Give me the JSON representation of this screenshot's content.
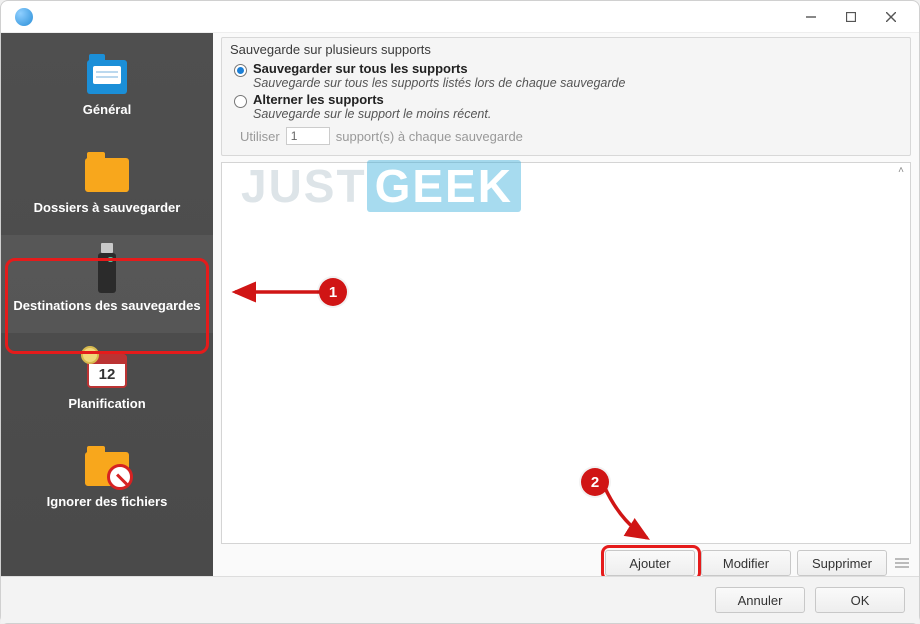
{
  "titlebar": {
    "app_name": ""
  },
  "sidebar": {
    "items": [
      {
        "label": "Général",
        "icon": "settings-folder-icon"
      },
      {
        "label": "Dossiers à sauvegarder",
        "icon": "folder-icon"
      },
      {
        "label": "Destinations des sauvegardes",
        "icon": "usb-icon"
      },
      {
        "label": "Planification",
        "icon": "calendar-icon",
        "calendar_day": "12"
      },
      {
        "label": "Ignorer des fichiers",
        "icon": "folder-blocked-icon"
      }
    ],
    "active_index": 2
  },
  "group": {
    "title": "Sauvegarde sur plusieurs supports",
    "option_all": {
      "label": "Sauvegarder sur tous les supports",
      "desc": "Sauvegarde sur tous les supports listés lors de chaque sauvegarde"
    },
    "option_alt": {
      "label": "Alterner les supports",
      "desc": "Sauvegarde sur le support le moins récent."
    },
    "stepper_prefix": "Utiliser",
    "stepper_value": "1",
    "stepper_suffix": "support(s) à chaque sauvegarde"
  },
  "list_buttons": {
    "add": "Ajouter",
    "edit": "Modifier",
    "delete": "Supprimer"
  },
  "footer": {
    "cancel": "Annuler",
    "ok": "OK"
  },
  "annotations": {
    "badge1": "1",
    "badge2": "2"
  },
  "watermark": {
    "part1": "JUST",
    "part2": "GEEK"
  }
}
